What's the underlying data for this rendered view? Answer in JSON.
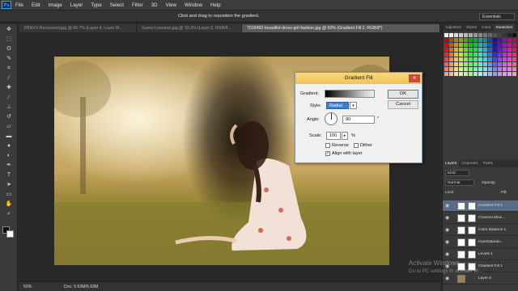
{
  "app": {
    "logo": "Ps"
  },
  "menu": [
    "File",
    "Edit",
    "Image",
    "Layer",
    "Type",
    "Select",
    "Filter",
    "3D",
    "View",
    "Window",
    "Help"
  ],
  "options_bar": {
    "hint": "Click and drag to reposition the gradient.",
    "workspace": "Essentials"
  },
  "document_tabs": [
    {
      "label": "FBNXV-Recovered.jpg @ 66.7% (Layer 4, Layer M...",
      "active": false
    },
    {
      "label": "Sunny Leoneon.jpg @ 33.3% (Layer 2, RGB/8...",
      "active": false
    },
    {
      "label": "7016492-beautiful-dress-girl-fashion.jpg @ 50% (Gradient Fill 2, RGB/8*)",
      "active": true
    }
  ],
  "status": {
    "zoom": "50%",
    "doc": "Doc: 5.93M/5.93M"
  },
  "panels": {
    "top_tabs": [
      "Adjustme",
      "Styles",
      "Color",
      "Swatches"
    ],
    "layers_tabs": [
      "Layers",
      "Channels",
      "Paths"
    ],
    "kind_label": "Kind",
    "blend_mode": "Normal",
    "opacity_label": "Opacity:",
    "lock_label": "Lock:",
    "fill_label": "Fill:",
    "layers": [
      {
        "name": "Gradient Fill 2",
        "selected": true
      },
      {
        "name": "Channel Mixe...",
        "selected": false
      },
      {
        "name": "Color Balance 1",
        "selected": false
      },
      {
        "name": "Hue/Saturati...",
        "selected": false
      },
      {
        "name": "Levels 1",
        "selected": false
      },
      {
        "name": "Gradient Fill 1",
        "selected": false
      },
      {
        "name": "Layer 0",
        "selected": false
      }
    ]
  },
  "dialog": {
    "title": "Gradient Fill",
    "gradient_label": "Gradient:",
    "style_label": "Style:",
    "style_value": "Radial",
    "angle_label": "Angle:",
    "angle_value": "90",
    "angle_unit": "°",
    "scale_label": "Scale:",
    "scale_value": "100",
    "scale_unit": "%",
    "reverse_label": "Reverse",
    "dither_label": "Dither",
    "align_label": "Align with layer",
    "ok_label": "OK",
    "cancel_label": "Cancel",
    "close_symbol": "✕"
  },
  "watermark": {
    "line1": "Activate Windows",
    "line2": "Go to PC settings to activate W..."
  },
  "colors": {
    "accent": "#31a8ff",
    "dialog_title": "#f0c85c",
    "selected_layer": "#5a6b86"
  }
}
